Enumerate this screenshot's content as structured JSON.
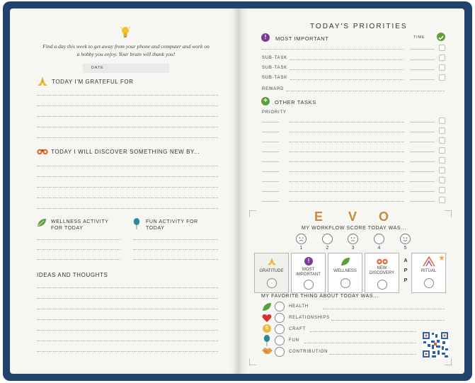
{
  "left": {
    "intro": "Find a day this week to get away from your phone and computer and work on a hobby you enjoy. Your brain will thank you!",
    "date_label": "DATE",
    "grateful_title": "TODAY I'M GRATEFUL FOR",
    "discover_title": "TODAY I WILL DISCOVER SOMETHING NEW BY...",
    "wellness_title": "WELLNESS ACTIVITY FOR TODAY",
    "fun_title": "FUN ACTIVITY FOR TODAY",
    "ideas_title": "IDEAS AND THOUGHTS"
  },
  "right": {
    "title": "TODAY'S PRIORITIES",
    "most_important": "MOST IMPORTANT",
    "time_label": "TIME",
    "subtask_labels": [
      "SUB-TASK",
      "SUB-TASK",
      "SUB-TASK"
    ],
    "reward_label": "REWARD",
    "other_tasks": "OTHER TASKS",
    "priority_label": "PRIORITY",
    "evo_letters": [
      "E",
      "V",
      "O"
    ],
    "workflow_title": "MY WORKFLOW SCORE TODAY WAS...",
    "scores": [
      "1",
      "2",
      "3",
      "4",
      "5"
    ],
    "cards": [
      "GRATITUDE",
      "MOST IMPORTANT",
      "WELLNESS",
      "NEW DISCOVERY",
      "RITUAL"
    ],
    "app_letters": [
      "A",
      "P",
      "P"
    ],
    "favorite_title": "MY FAVORITE THING ABOUT TODAY WAS...",
    "favorites": [
      "HEALTH",
      "RELATIONSHIPS",
      "CRAFT",
      "FUN",
      "CONTRIBUTION"
    ]
  },
  "colors": {
    "cover": "#22426e",
    "paper": "#f6f6f3",
    "purple": "#7b3b96",
    "green": "#5e9e3b",
    "orange": "#e2652d",
    "gold": "#c8893f",
    "teal": "#2a8a93"
  },
  "icons": [
    "lightbulb-icon",
    "praying-hands-icon",
    "binoculars-icon",
    "leaf-icon",
    "balloon-icon",
    "exclamation-icon",
    "plus-icon",
    "check-icon",
    "heart-icon",
    "coin-icon",
    "handshake-icon",
    "qr-code"
  ]
}
